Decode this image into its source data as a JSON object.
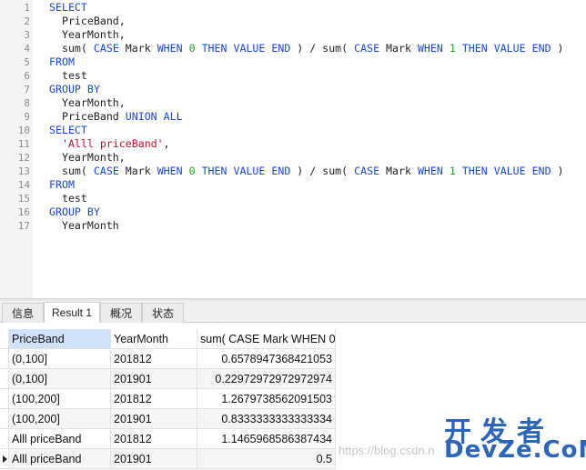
{
  "editor": {
    "line_numbers": [
      "1",
      "2",
      "3",
      "4",
      "5",
      "6",
      "7",
      "8",
      "9",
      "10",
      "11",
      "12",
      "13",
      "14",
      "15",
      "16",
      "17"
    ],
    "lines": [
      [
        {
          "t": "kw",
          "v": "SELECT"
        }
      ],
      [
        {
          "t": "plain",
          "v": "  PriceBand,"
        }
      ],
      [
        {
          "t": "plain",
          "v": "  YearMonth,"
        }
      ],
      [
        {
          "t": "plain",
          "v": "  sum( "
        },
        {
          "t": "kw",
          "v": "CASE"
        },
        {
          "t": "plain",
          "v": " Mark "
        },
        {
          "t": "kw",
          "v": "WHEN"
        },
        {
          "t": "plain",
          "v": " "
        },
        {
          "t": "num",
          "v": "0"
        },
        {
          "t": "plain",
          "v": " "
        },
        {
          "t": "kw",
          "v": "THEN"
        },
        {
          "t": "plain",
          "v": " "
        },
        {
          "t": "kw",
          "v": "VALUE"
        },
        {
          "t": "plain",
          "v": " "
        },
        {
          "t": "kw",
          "v": "END"
        },
        {
          "t": "plain",
          "v": " ) / sum( "
        },
        {
          "t": "kw",
          "v": "CASE"
        },
        {
          "t": "plain",
          "v": " Mark "
        },
        {
          "t": "kw",
          "v": "WHEN"
        },
        {
          "t": "plain",
          "v": " "
        },
        {
          "t": "num",
          "v": "1"
        },
        {
          "t": "plain",
          "v": " "
        },
        {
          "t": "kw",
          "v": "THEN"
        },
        {
          "t": "plain",
          "v": " "
        },
        {
          "t": "kw",
          "v": "VALUE"
        },
        {
          "t": "plain",
          "v": " "
        },
        {
          "t": "kw",
          "v": "END"
        },
        {
          "t": "plain",
          "v": " )"
        }
      ],
      [
        {
          "t": "kw",
          "v": "FROM"
        }
      ],
      [
        {
          "t": "plain",
          "v": "  test"
        }
      ],
      [
        {
          "t": "kw",
          "v": "GROUP BY"
        }
      ],
      [
        {
          "t": "plain",
          "v": "  YearMonth,"
        }
      ],
      [
        {
          "t": "plain",
          "v": "  PriceBand "
        },
        {
          "t": "kw",
          "v": "UNION ALL"
        }
      ],
      [
        {
          "t": "kw",
          "v": "SELECT"
        }
      ],
      [
        {
          "t": "plain",
          "v": "  "
        },
        {
          "t": "str",
          "v": "'Alll priceBand'"
        },
        {
          "t": "plain",
          "v": ","
        }
      ],
      [
        {
          "t": "plain",
          "v": "  YearMonth,"
        }
      ],
      [
        {
          "t": "plain",
          "v": "  sum( "
        },
        {
          "t": "kw",
          "v": "CASE"
        },
        {
          "t": "plain",
          "v": " Mark "
        },
        {
          "t": "kw",
          "v": "WHEN"
        },
        {
          "t": "plain",
          "v": " "
        },
        {
          "t": "num",
          "v": "0"
        },
        {
          "t": "plain",
          "v": " "
        },
        {
          "t": "kw",
          "v": "THEN"
        },
        {
          "t": "plain",
          "v": " "
        },
        {
          "t": "kw",
          "v": "VALUE"
        },
        {
          "t": "plain",
          "v": " "
        },
        {
          "t": "kw",
          "v": "END"
        },
        {
          "t": "plain",
          "v": " ) / sum( "
        },
        {
          "t": "kw",
          "v": "CASE"
        },
        {
          "t": "plain",
          "v": " Mark "
        },
        {
          "t": "kw",
          "v": "WHEN"
        },
        {
          "t": "plain",
          "v": " "
        },
        {
          "t": "num",
          "v": "1"
        },
        {
          "t": "plain",
          "v": " "
        },
        {
          "t": "kw",
          "v": "THEN"
        },
        {
          "t": "plain",
          "v": " "
        },
        {
          "t": "kw",
          "v": "VALUE"
        },
        {
          "t": "plain",
          "v": " "
        },
        {
          "t": "kw",
          "v": "END"
        },
        {
          "t": "plain",
          "v": " )"
        }
      ],
      [
        {
          "t": "kw",
          "v": "FROM"
        }
      ],
      [
        {
          "t": "plain",
          "v": "  test"
        }
      ],
      [
        {
          "t": "kw",
          "v": "GROUP BY"
        }
      ],
      [
        {
          "t": "plain",
          "v": "  YearMonth"
        }
      ]
    ]
  },
  "tabs": [
    {
      "label": "信息",
      "active": false
    },
    {
      "label": "Result 1",
      "active": true
    },
    {
      "label": "概况",
      "active": false
    },
    {
      "label": "状态",
      "active": false
    }
  ],
  "grid": {
    "columns": [
      "PriceBand",
      "YearMonth",
      "sum( CASE Mark WHEN 0"
    ],
    "rows": [
      [
        "(0,100]",
        "201812",
        "0.6578947368421053"
      ],
      [
        "(0,100]",
        "201901",
        "0.22972972972972974"
      ],
      [
        "(100,200]",
        "201812",
        "1.2679738562091503"
      ],
      [
        "(100,200]",
        "201901",
        "0.8333333333333334"
      ],
      [
        "Alll priceBand",
        "201812",
        "1.1465968586387434"
      ],
      [
        "Alll priceBand",
        "201901",
        "0.5"
      ]
    ],
    "current_row": 5
  },
  "watermark": {
    "url": "https://blog.csdn.n",
    "logo_cn": "开发者",
    "logo_en": "DevZe.CoM"
  }
}
